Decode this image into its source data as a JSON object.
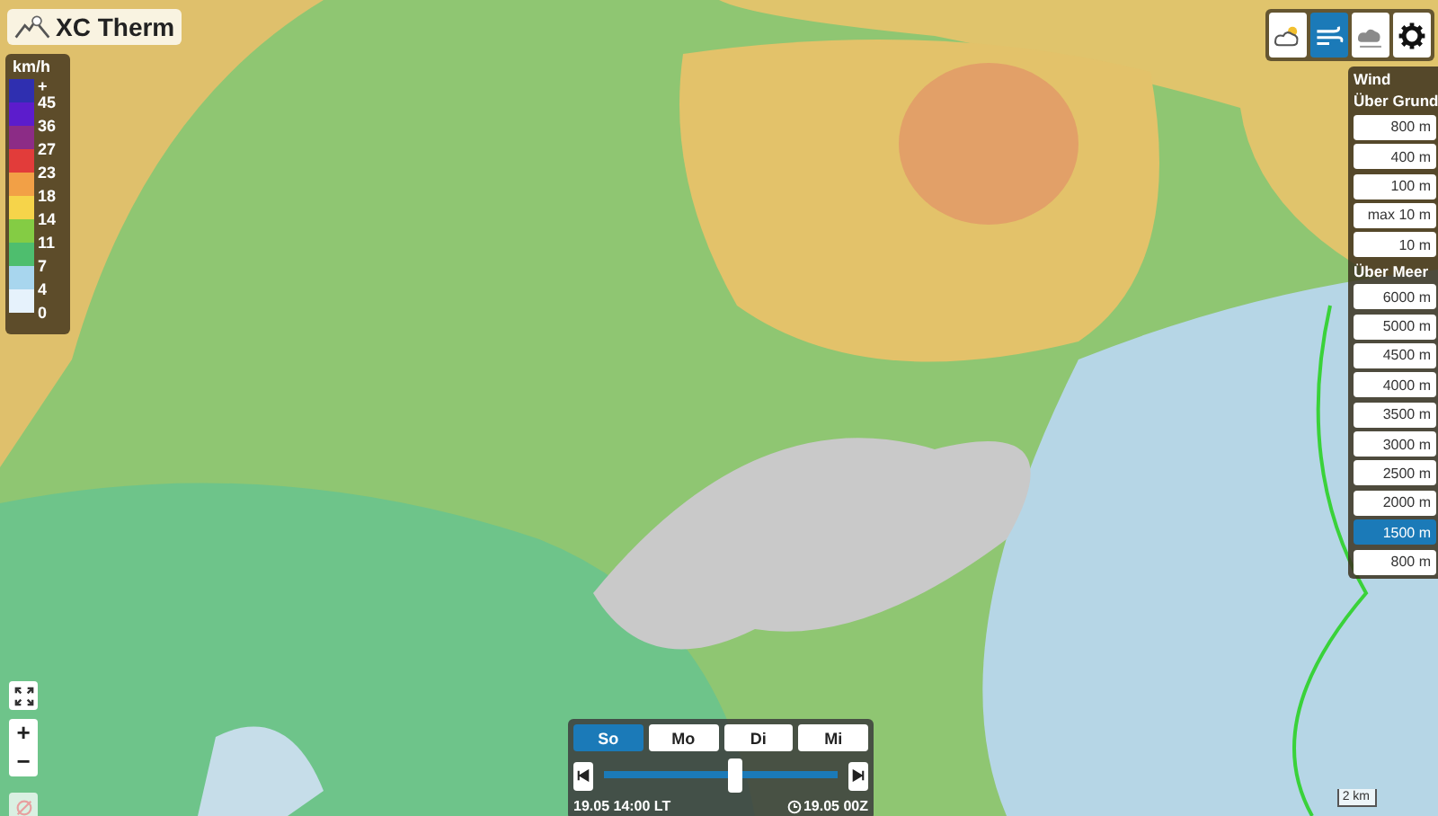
{
  "app": {
    "title": "XC Therm"
  },
  "legend": {
    "unit": "km/h",
    "items": [
      {
        "label": "+",
        "color": "#2f2fb0"
      },
      {
        "label": "45",
        "color": "#5c1ccc"
      },
      {
        "label": "36",
        "color": "#8c2c86"
      },
      {
        "label": "27",
        "color": "#e23c3a"
      },
      {
        "label": "23",
        "color": "#f2a046"
      },
      {
        "label": "18",
        "color": "#f6d44a"
      },
      {
        "label": "14",
        "color": "#84cc44"
      },
      {
        "label": "11",
        "color": "#4ebe6e"
      },
      {
        "label": "7",
        "color": "#a8d6ee"
      },
      {
        "label": "4",
        "color": "#e6f2fc"
      }
    ],
    "bottom_label": "0"
  },
  "toolbar": [
    {
      "kind": "weather",
      "selected": false
    },
    {
      "kind": "wind",
      "selected": true
    },
    {
      "kind": "cloud",
      "selected": false
    },
    {
      "kind": "settings",
      "selected": false
    }
  ],
  "wind_panel": {
    "title": "Wind",
    "groups": [
      {
        "heading": "Über Grund",
        "options": [
          {
            "label": "800 m",
            "selected": false
          },
          {
            "label": "400 m",
            "selected": false
          },
          {
            "label": "100 m",
            "selected": false
          },
          {
            "label": "max 10 m",
            "selected": false
          },
          {
            "label": "10 m",
            "selected": false
          }
        ]
      },
      {
        "heading": "Über Meer",
        "options": [
          {
            "label": "6000 m",
            "selected": false
          },
          {
            "label": "5000 m",
            "selected": false
          },
          {
            "label": "4500 m",
            "selected": false
          },
          {
            "label": "4000 m",
            "selected": false
          },
          {
            "label": "3500 m",
            "selected": false
          },
          {
            "label": "3000 m",
            "selected": false
          },
          {
            "label": "2500 m",
            "selected": false
          },
          {
            "label": "2000 m",
            "selected": false
          },
          {
            "label": "1500 m",
            "selected": true
          },
          {
            "label": "800 m",
            "selected": false
          }
        ]
      }
    ]
  },
  "timeline": {
    "days": [
      {
        "label": "So",
        "selected": true
      },
      {
        "label": "Mo",
        "selected": false
      },
      {
        "label": "Di",
        "selected": false
      },
      {
        "label": "Mi",
        "selected": false
      }
    ],
    "level": 0.56,
    "local_time": "19.05 14:00 LT",
    "utc_time": "19.05 00Z"
  },
  "map_controls": {
    "zoom_in": "+",
    "zoom_out": "−"
  },
  "scale": {
    "label": "2 km"
  }
}
